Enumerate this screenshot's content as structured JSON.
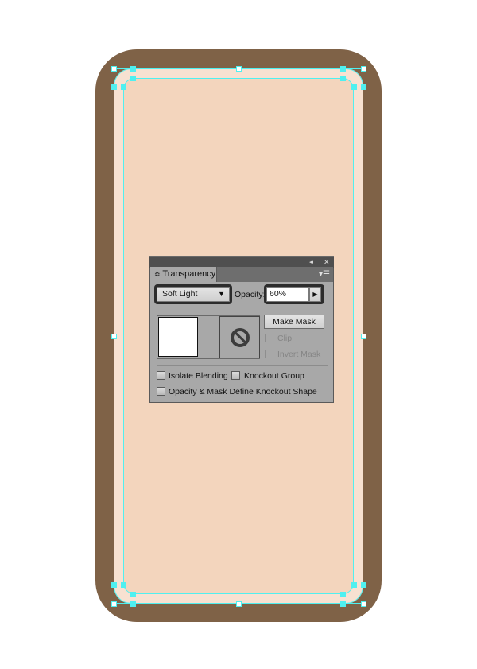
{
  "colors": {
    "body": "#7f6247",
    "bezel": "#f7e1d1",
    "screen": "#f3d5bd",
    "selection": "#4ff0f0"
  },
  "panel": {
    "title_icons": {
      "collapse": "double-chevron-left-icon",
      "close": "close-icon"
    },
    "collapse_glyph": "◂◂",
    "close_glyph": "✕",
    "tab_label": "Transparency",
    "tab_prefix_glyph": "≎",
    "menu_glyph": "▾☰",
    "blend_mode": "Soft Light",
    "blend_arrow": "▼",
    "opacity_label": "Opacity:",
    "opacity_value": "60%",
    "opacity_arrow": "▶",
    "make_mask_label": "Make Mask",
    "clip_label": "Clip",
    "invert_mask_label": "Invert Mask",
    "isolate_blending_label": "Isolate Blending",
    "knockout_group_label": "Knockout Group",
    "define_knockout_label": "Opacity & Mask Define Knockout Shape"
  }
}
